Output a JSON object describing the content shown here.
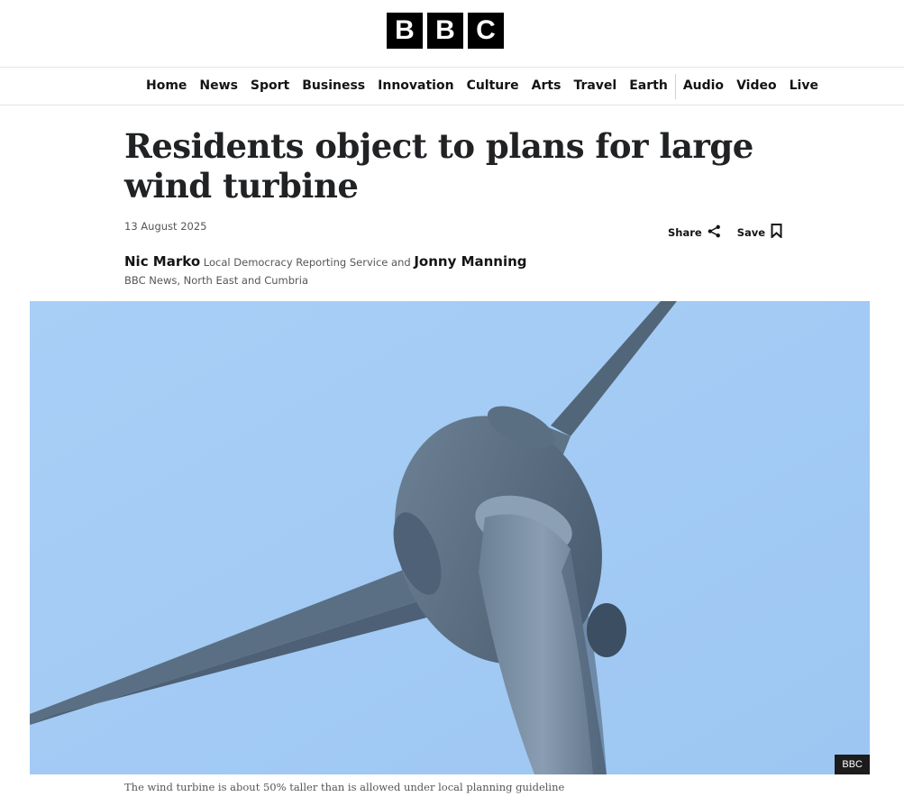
{
  "brand": {
    "logo_letters": [
      "B",
      "B",
      "C"
    ]
  },
  "nav": {
    "primary": [
      "Home",
      "News",
      "Sport",
      "Business",
      "Innovation",
      "Culture",
      "Arts",
      "Travel",
      "Earth"
    ],
    "secondary": [
      "Audio",
      "Video",
      "Live"
    ]
  },
  "article": {
    "headline": "Residents object to plans for large wind turbine",
    "date": "13 August 2025",
    "share_label": "Share",
    "save_label": "Save",
    "byline": {
      "author1": "Nic Marko",
      "author1_org": "Local Democracy Reporting Service and",
      "author2": "Jonny Manning",
      "author2_org": "BBC News, North East and Cumbria"
    },
    "image": {
      "credit": "BBC",
      "caption": "The wind turbine is about 50% taller than is allowed under local planning guideline"
    }
  },
  "colors": {
    "sky": "#a3cbf4",
    "turbine": "#5e7386",
    "text": "#141414",
    "muted": "#545658"
  },
  "icons": [
    "share-icon",
    "bookmark-icon"
  ]
}
